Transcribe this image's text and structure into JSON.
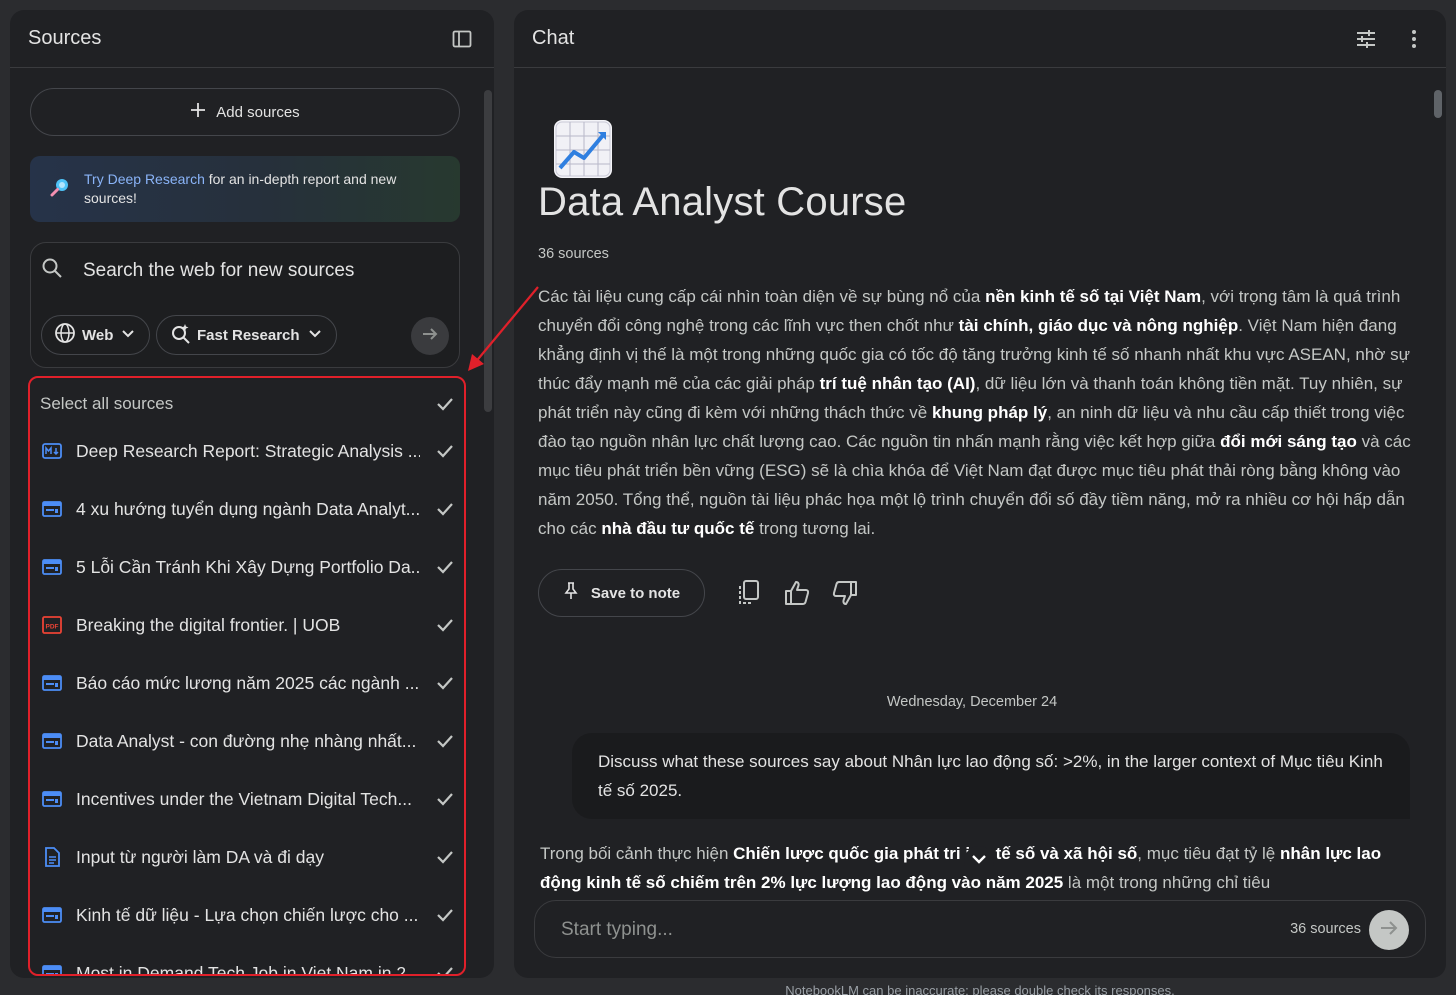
{
  "sources_panel": {
    "title": "Sources",
    "add_sources_label": "Add sources",
    "banner_link": "Try Deep Research",
    "banner_text": " for an in-depth report and new sources!",
    "search_placeholder": "Search the web for new sources",
    "chip_web": "Web",
    "chip_research": "Fast Research",
    "select_all_label": "Select all sources",
    "items": [
      {
        "label": "Deep Research Report: Strategic Analysis ...",
        "icon": "markdown-doc-icon"
      },
      {
        "label": "4 xu hướng tuyển dụng ngành Data Analyt...",
        "icon": "web-page-icon"
      },
      {
        "label": "5 Lỗi Cần Tránh Khi Xây Dựng Portfolio Da...",
        "icon": "web-page-icon"
      },
      {
        "label": "Breaking the digital frontier. | UOB",
        "icon": "pdf-icon"
      },
      {
        "label": "Báo cáo mức lương năm 2025 các ngành ...",
        "icon": "web-page-icon"
      },
      {
        "label": "Data Analyst - con đường nhẹ nhàng nhất...",
        "icon": "web-page-icon"
      },
      {
        "label": "Incentives under the Vietnam Digital Tech...",
        "icon": "web-page-icon"
      },
      {
        "label": "Input từ người làm DA và đi dạy",
        "icon": "text-doc-icon"
      },
      {
        "label": "Kinh tế dữ liệu - Lựa chọn chiến lược cho ...",
        "icon": "web-page-icon"
      },
      {
        "label": "Most in Demand Tech Job in Viet Nam in 2...",
        "icon": "web-page-icon"
      }
    ]
  },
  "chat_panel": {
    "title": "Chat",
    "notebook_title": "Data Analyst Course",
    "source_count": "36 sources",
    "summary_parts": [
      {
        "t": "Các tài liệu cung cấp cái nhìn toàn diện về sự bùng nổ của ",
        "b": false
      },
      {
        "t": "nền kinh tế số tại Việt Nam",
        "b": true
      },
      {
        "t": ", với trọng tâm là quá trình chuyển đổi công nghệ trong các lĩnh vực then chốt như ",
        "b": false
      },
      {
        "t": "tài chính, giáo dục và nông nghiệp",
        "b": true
      },
      {
        "t": ". Việt Nam hiện đang khẳng định vị thế là một trong những quốc gia có tốc độ tăng trưởng kinh tế số nhanh nhất khu vực ASEAN, nhờ sự thúc đẩy mạnh mẽ của các giải pháp ",
        "b": false
      },
      {
        "t": "trí tuệ nhân tạo (AI)",
        "b": true
      },
      {
        "t": ", dữ liệu lớn và thanh toán không tiền mặt. Tuy nhiên, sự phát triển này cũng đi kèm với những thách thức về ",
        "b": false
      },
      {
        "t": "khung pháp lý",
        "b": true
      },
      {
        "t": ", an ninh dữ liệu và nhu cầu cấp thiết trong việc đào tạo nguồn nhân lực chất lượng cao. Các nguồn tin nhấn mạnh rằng việc kết hợp giữa ",
        "b": false
      },
      {
        "t": "đổi mới sáng tạo",
        "b": true
      },
      {
        "t": " và các mục tiêu phát triển bền vững (ESG) sẽ là chìa khóa để Việt Nam đạt được mục tiêu phát thải ròng bằng không vào năm 2050. Tổng thể, nguồn tài liệu phác họa một lộ trình chuyển đổi số đầy tiềm năng, mở ra nhiều cơ hội hấp dẫn cho các ",
        "b": false
      },
      {
        "t": "nhà đầu tư quốc tế",
        "b": true
      },
      {
        "t": " trong tương lai.",
        "b": false
      }
    ],
    "save_note_label": "Save to note",
    "date_separator": "Wednesday, December 24",
    "user_message": "Discuss what these sources say about Nhân lực lao động số: >2%, in the larger context of Mục tiêu Kinh tế số 2025.",
    "answer_parts": [
      {
        "t": "Trong bối cảnh thực hiện ",
        "b": false
      },
      {
        "t": "Chiến lược quốc gia phát tri",
        "b": true
      },
      {
        "t": "     ",
        "b": false
      },
      {
        "t": "inh tế số và xã hội số",
        "b": true
      },
      {
        "t": ", mục tiêu đạt tỷ lệ ",
        "b": false
      },
      {
        "t": "nhân lực lao động kinh tế số chiếm trên 2% lực lượng lao động vào năm 2025",
        "b": true
      },
      {
        "t": " là một trong những chỉ tiêu",
        "b": false
      }
    ],
    "input_placeholder": "Start typing...",
    "input_source_count": "36 sources"
  },
  "footer_note": "NotebookLM can be inaccurate; please double check its responses.",
  "colors": {
    "background": "#2b2c2f",
    "panel": "#202124",
    "accent_link": "#8ab4f8",
    "highlight_red": "#e0202a",
    "source_icon_blue": "#4c8df6",
    "pdf_icon_red": "#ea4335"
  }
}
